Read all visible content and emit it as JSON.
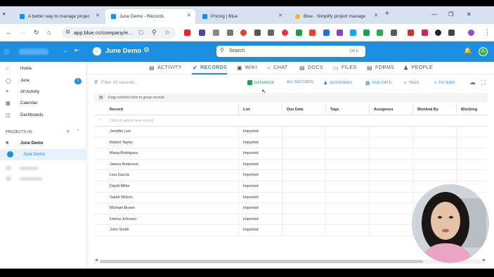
{
  "browser": {
    "tabs": [
      {
        "label": "A better way to manage projec",
        "favicon_color": "#1d8fe0"
      },
      {
        "label": "June Demo - Records",
        "favicon_color": "#1d8fe0",
        "favicon_text": "blue",
        "active": true
      },
      {
        "label": "Pricing | Blue",
        "favicon_color": "#1d8fe0"
      },
      {
        "label": "Blue - Simplify project manage",
        "favicon_color": "#f2b233"
      }
    ],
    "url": "app.blue.cc/company/e..."
  },
  "app": {
    "project_title": "June Demo",
    "search": {
      "placeholder": "Search",
      "shortcut": "Ctrl K"
    },
    "avatar_initial": "JL",
    "accent": "#1d8fe0"
  },
  "sidebar": {
    "items": [
      {
        "label": "Home",
        "icon": "home-icon"
      },
      {
        "label": "June",
        "icon": "check-circle-icon",
        "badge": "1"
      },
      {
        "label": "All Activity",
        "icon": "activity-icon"
      },
      {
        "label": "Calendar",
        "icon": "calendar-icon"
      },
      {
        "label": "Dashboards",
        "icon": "dashboard-icon"
      }
    ],
    "projects_header": "PROJECTS (4)",
    "projects": [
      {
        "label": "June Demo",
        "icon": "folder-icon"
      },
      {
        "label": "June Demo",
        "icon": "project-avatar-icon",
        "active": true
      }
    ]
  },
  "main": {
    "tabs": [
      {
        "label": "ACTIVITY",
        "icon": "activity-icon"
      },
      {
        "label": "RECORDS",
        "icon": "check-circle-icon",
        "active": true
      },
      {
        "label": "WIKI",
        "icon": "wiki-icon"
      },
      {
        "label": "CHAT",
        "icon": "chat-icon"
      },
      {
        "label": "DOCS",
        "icon": "docs-icon"
      },
      {
        "label": "FILES",
        "icon": "files-icon"
      },
      {
        "label": "FORMS",
        "icon": "forms-icon"
      },
      {
        "label": "PEOPLE",
        "icon": "people-icon"
      }
    ],
    "filter_placeholder": "Filter 10 records...",
    "toolbar": {
      "database": "DATABASE",
      "all_records": "ALL RECORDS",
      "assignees": "ASSIGNEES",
      "due_date": "DUE DATE",
      "tags": "TAGS",
      "filters": "FILTERS"
    },
    "group_hint": "Drag columns here to group records",
    "add_record": "Click to add a new record",
    "columns": [
      "Record",
      "List",
      "Due Date",
      "Tags",
      "Assignees",
      "Blocked By",
      "Blocking"
    ],
    "rows": [
      {
        "record": "Jennifer Lee",
        "list": "Imported"
      },
      {
        "record": "Robert Taylor",
        "list": "Imported"
      },
      {
        "record": "Maria Rodriguez",
        "list": "Imported"
      },
      {
        "record": "James Anderson",
        "list": "Imported"
      },
      {
        "record": "Lisa Garcia",
        "list": "Imported"
      },
      {
        "record": "David Miller",
        "list": "Imported"
      },
      {
        "record": "Sarah Wilson",
        "list": "Imported"
      },
      {
        "record": "Michael Brown",
        "list": "Imported"
      },
      {
        "record": "Emma Johnson",
        "list": "Imported"
      },
      {
        "record": "John Smith",
        "list": "Imported"
      }
    ]
  }
}
